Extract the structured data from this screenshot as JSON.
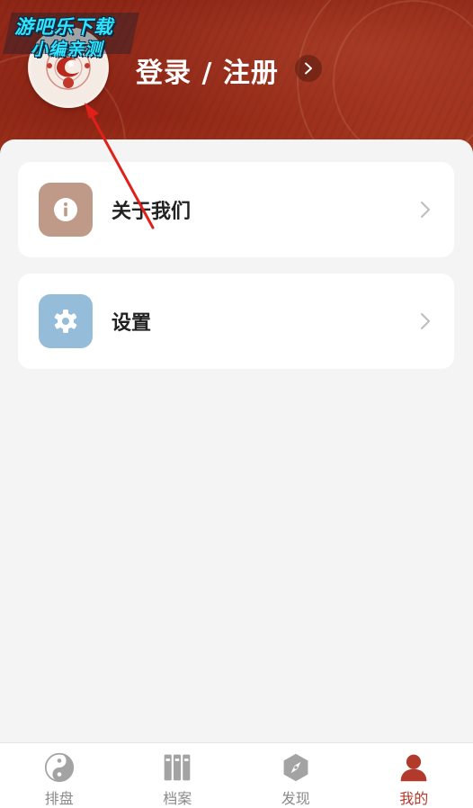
{
  "header": {
    "title": "登录 / 注册",
    "avatar_icon": "app-logo-icon",
    "arrow_icon": "chevron-right-icon"
  },
  "watermark": {
    "line1": "游吧乐下载",
    "line2": "小编亲测"
  },
  "menu": {
    "items": [
      {
        "label": "关于我们",
        "icon": "info-icon",
        "icon_bg": "#c09a88"
      },
      {
        "label": "设置",
        "icon": "gear-icon",
        "icon_bg": "#95bcd8"
      }
    ]
  },
  "tabbar": {
    "tabs": [
      {
        "label": "排盘",
        "icon": "yin-yang-icon",
        "active": false
      },
      {
        "label": "档案",
        "icon": "archive-binders-icon",
        "active": false
      },
      {
        "label": "发现",
        "icon": "compass-icon",
        "active": false
      },
      {
        "label": "我的",
        "icon": "person-icon",
        "active": true
      }
    ]
  },
  "colors": {
    "header_bg": "#9b2f1c",
    "accent": "#b23a2c",
    "inactive_tab": "#8a8a8a",
    "page_bg": "#f4f4f4"
  }
}
